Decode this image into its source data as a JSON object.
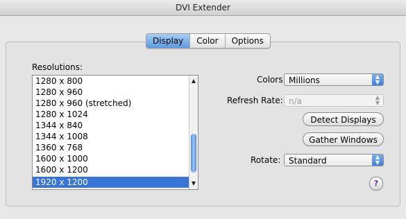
{
  "window": {
    "title": "DVI Extender"
  },
  "tabs": [
    {
      "label": "Display",
      "active": true
    },
    {
      "label": "Color",
      "active": false
    },
    {
      "label": "Options",
      "active": false
    }
  ],
  "resolutions": {
    "label": "Resolutions:",
    "items": [
      "1280 x 800",
      "1280 x 960",
      "1280 x 960 (stretched)",
      "1280 x 1024",
      "1344 x 840",
      "1344 x 1008",
      "1360 x 768",
      "1600 x 1000",
      "1600 x 1200",
      "1920 x 1200"
    ],
    "selected": "1920 x 1200"
  },
  "colors": {
    "label": "Colors:",
    "value": "Millions"
  },
  "refresh_rate": {
    "label": "Refresh Rate:",
    "value": "n/a"
  },
  "buttons": {
    "detect": "Detect Displays",
    "gather": "Gather Windows"
  },
  "rotate": {
    "label": "Rotate:",
    "value": "Standard"
  },
  "help": {
    "symbol": "?"
  },
  "icons": {
    "popup_arrows": "up-down-arrows-icon",
    "help": "help-icon"
  },
  "accent": "#3875d7"
}
